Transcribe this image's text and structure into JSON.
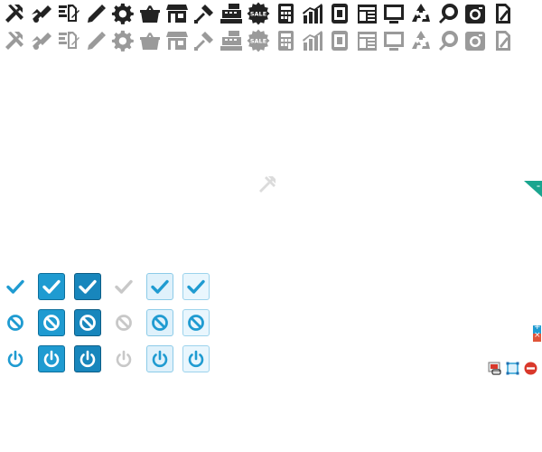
{
  "sprite": {
    "rows": [
      {
        "style": "dark",
        "icons": [
          "tools-icon",
          "tools-flip-icon",
          "document-pen-icon",
          "pencil-icon",
          "gear-icon",
          "shopping-basket-icon",
          "storefront-icon",
          "screwdriver-icon",
          "cash-register-icon",
          "sale-badge-icon",
          "calculator-icon",
          "bar-chart-icon",
          "mobile-tablet-icon",
          "newspaper-icon",
          "monitor-icon",
          "recycle-icon",
          "magnifier-icon",
          "camera-icon",
          "edit-document-icon"
        ]
      },
      {
        "style": "light",
        "icons": [
          "tools-icon",
          "tools-flip-icon",
          "document-pen-icon",
          "pencil-icon",
          "gear-icon",
          "shopping-basket-icon",
          "storefront-icon",
          "screwdriver-icon",
          "cash-register-icon",
          "sale-badge-icon",
          "calculator-icon",
          "bar-chart-icon",
          "mobile-tablet-icon",
          "newspaper-icon",
          "monitor-icon",
          "recycle-icon",
          "magnifier-icon",
          "camera-icon",
          "edit-document-icon"
        ]
      }
    ],
    "sale_label": "SALE"
  },
  "buttons": {
    "rows": [
      {
        "name": "check",
        "icon": "check-icon"
      },
      {
        "name": "block",
        "icon": "block-icon"
      },
      {
        "name": "power",
        "icon": "power-icon"
      }
    ],
    "states": [
      "plain-blue",
      "solid",
      "solid-pressed",
      "plain-gray",
      "light",
      "light-alt"
    ]
  },
  "misc": {
    "corner_badge": {
      "symbol": "–",
      "color": "#1aa58f"
    },
    "mini_buttons": [
      {
        "name": "expand-button",
        "symbol": "+",
        "color": "#1f9bd1"
      },
      {
        "name": "close-small-button",
        "symbol": "×",
        "color": "#e0553a"
      }
    ],
    "action_icons": [
      "image-link-icon",
      "crop-icon",
      "remove-icon"
    ]
  },
  "colors": {
    "icon_dark": "#222222",
    "icon_light": "#9a9a9a",
    "accent_blue": "#1f9bd1",
    "muted_gray": "#c8c8c8",
    "remove_red": "#d9382b"
  }
}
